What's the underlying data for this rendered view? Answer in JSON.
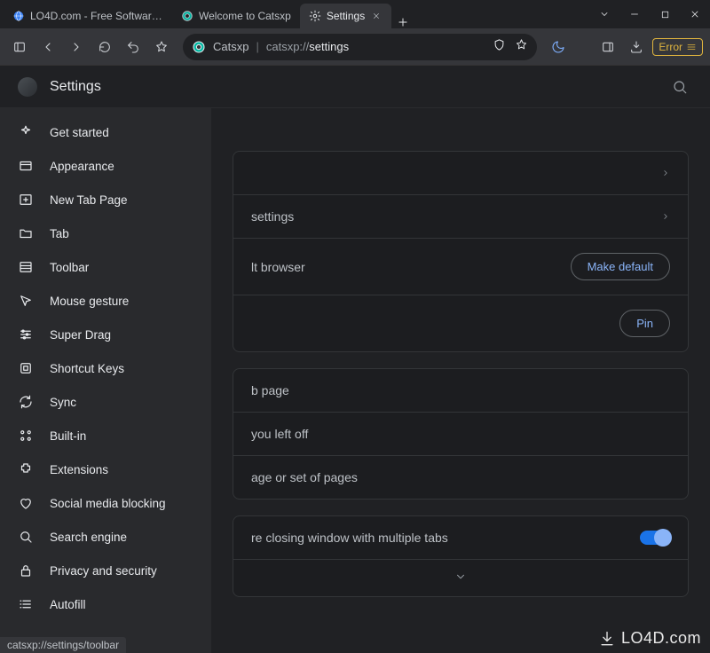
{
  "window": {
    "tabs": [
      {
        "title": "LO4D.com - Free Software Do",
        "active": false
      },
      {
        "title": "Welcome to Catsxp",
        "active": false
      },
      {
        "title": "Settings",
        "active": true
      }
    ]
  },
  "toolbar": {
    "address_host": "Catsxp",
    "address_scheme": "catsxp://",
    "address_path": "settings",
    "error_label": "Error"
  },
  "settings": {
    "title": "Settings",
    "sidebar_items": [
      "Get started",
      "Appearance",
      "New Tab Page",
      "Tab",
      "Toolbar",
      "Mouse gesture",
      "Super Drag",
      "Shortcut Keys",
      "Sync",
      "Built-in",
      "Extensions",
      "Social media blocking",
      "Search engine",
      "Privacy and security",
      "Autofill"
    ]
  },
  "content": {
    "row_settings_suffix": " settings",
    "row_default_browser": "lt browser",
    "make_default": "Make default",
    "pin": "Pin",
    "row_tab_page": "b page",
    "row_left_off": "you left off",
    "row_set_pages": "age or set of pages",
    "row_close_multi": "re closing window with multiple tabs"
  },
  "status_bar": "catsxp://settings/toolbar",
  "watermark": "LO4D.com"
}
